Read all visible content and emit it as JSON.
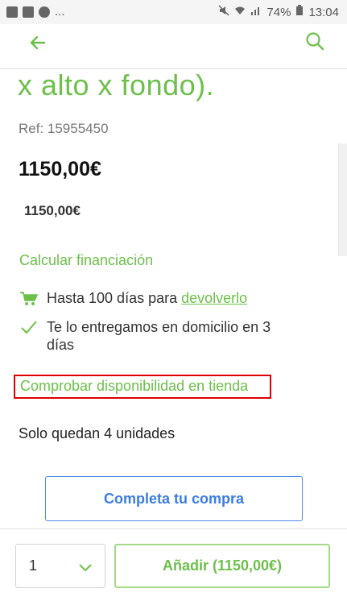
{
  "status_bar": {
    "battery": "74%",
    "time": "13:04",
    "notifications": "..."
  },
  "header": {
    "back_icon": "arrow-left-icon",
    "search_icon": "search-icon"
  },
  "product": {
    "title_fragment": "x alto x fondo).",
    "ref": "Ref: 15955450",
    "price": "1150,00€",
    "price_secondary": "1150,00€"
  },
  "links": {
    "financing": "Calcular financiación",
    "return_prefix": "Hasta 100 días para ",
    "return_link": "devolverlo",
    "delivery": "Te lo entregamos en domicilio en 3 días",
    "store_check": "Comprobar disponibilidad en tienda"
  },
  "stock": {
    "units_text": "Solo quedan 4 unidades"
  },
  "buttons": {
    "complete": "Completa tu compra",
    "add": "Añadir (1150,00€)"
  },
  "quantity": {
    "value": "1"
  },
  "colors": {
    "accent_green": "#6cc04a",
    "blue": "#3b7de0",
    "highlight_red": "#e00000"
  }
}
